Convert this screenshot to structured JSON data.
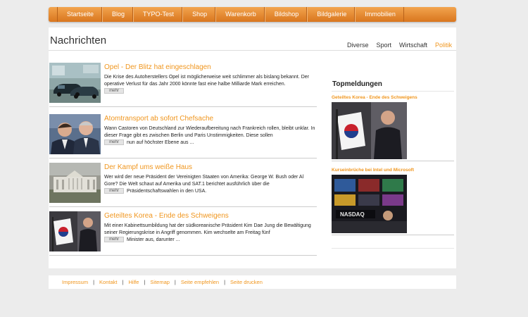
{
  "nav": {
    "items": [
      "Startseite",
      "Blog",
      "TYPO-Test",
      "Shop",
      "Warenkorb",
      "Bildshop",
      "Bildgalerie",
      "Immobilien"
    ]
  },
  "page": {
    "title": "Nachrichten",
    "categories": [
      "Diverse",
      "Sport",
      "Wirtschaft",
      "Politik"
    ],
    "active_category": "Politik"
  },
  "articles": [
    {
      "title": "Opel - Der Blitz hat eingeschlagen",
      "text": "Die Krise des Autoherstellers Opel ist möglicherweise weit schlimmer als bislang bekannt. Der operative Verlust für das Jahr 2000 könnte fast eine halbe Milliarde Mark erreichen.",
      "more": "mehr"
    },
    {
      "title": "Atomtransport ab sofort Chefsache",
      "text_before": "Wann Castoren von Deutschland zur Wiederaufbereitung nach Frankreich rollen, bleibt unklar. In dieser Frage gibt es zwischen Berlin und Paris Unstimmigkeiten. Diese sollen",
      "text_after": "nun auf höchster Ebene aus ...",
      "more": "mehr"
    },
    {
      "title": "Der Kampf ums weiße Haus",
      "text_before": "Wer wird der neue Präsident der Vereinigten Staaten von Amerika: George W. Bush oder Al Gore? Die Welt schaut auf Amerika und SAT.1 berichtet ausführlich über die",
      "text_after": "Präsidentschaftswahlen in den USA.",
      "more": "mehr"
    },
    {
      "title": "Geteiltes Korea - Ende des Schweigens",
      "text_before": "Mit einer Kabinettsumbildung hat der südkoreanische Präsident Kim Dae Jung die Bewältigung seiner Regierungskrise in Angriff genommen. Kim wechselte am Freitag fünf",
      "text_after": "Minister aus, darunter ...",
      "more": "mehr"
    }
  ],
  "sidebar": {
    "title": "Topmeldungen",
    "items": [
      {
        "title": "Geteiltes Korea - Ende des Schweigens"
      },
      {
        "title": "Kurseinbrüche bei Intel und Microsoft"
      }
    ]
  },
  "footer": {
    "links": [
      "Impressum",
      "Kontakt",
      "Hilfe",
      "Sitemap",
      "Seite empfehlen",
      "Seite drucken"
    ]
  },
  "colors": {
    "accent": "#f0961e",
    "nav_top": "#f2a44e",
    "nav_bottom": "#d9761e"
  }
}
